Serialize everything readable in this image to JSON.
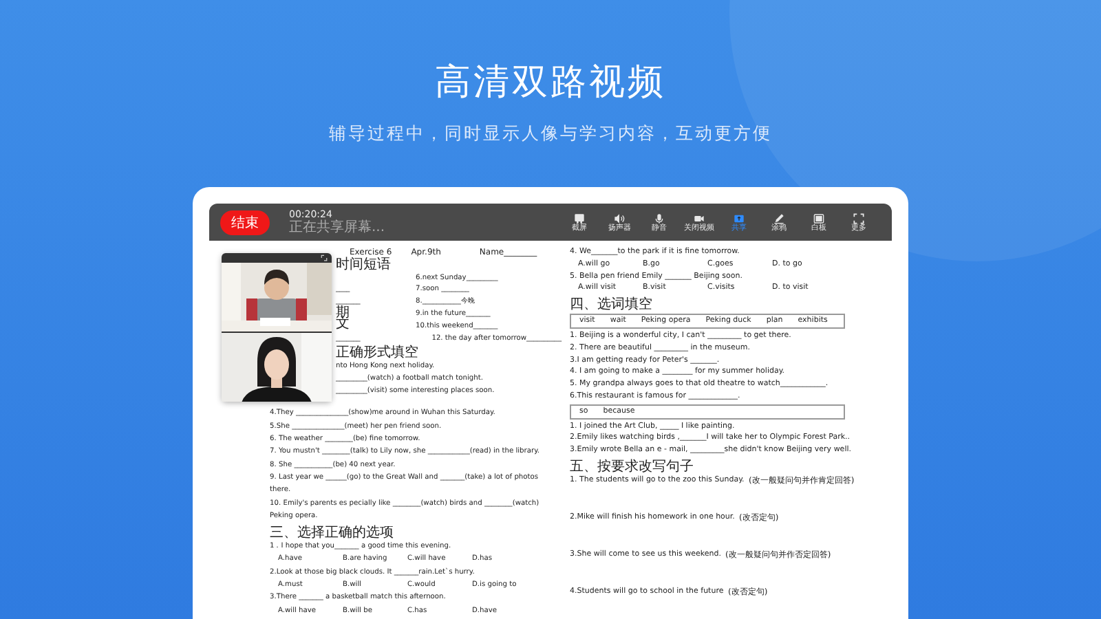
{
  "headline": "高清双路视频",
  "subheadline": "辅导过程中，同时显示人像与学习内容，互动更方便",
  "toolbar": {
    "end_button": "结束",
    "timer": "00:20:24",
    "status": "正在共享屏幕...",
    "tools": [
      {
        "label": "截屏",
        "selected": false
      },
      {
        "label": "扬声器",
        "selected": false
      },
      {
        "label": "静音",
        "selected": false
      },
      {
        "label": "关闭视频",
        "selected": false
      },
      {
        "label": "共享",
        "selected": true
      },
      {
        "label": "涂鸦",
        "selected": false
      },
      {
        "label": "白板",
        "selected": false
      },
      {
        "label": "更多",
        "selected": false
      }
    ]
  },
  "worksheet": {
    "header": [
      "Exercise 6",
      "Apr.9th",
      "Name________"
    ],
    "top_rows": [
      {
        "left": "时间短语",
        "right": ""
      },
      {
        "left": "",
        "right": "6.next Sunday_________"
      },
      {
        "left": "____",
        "right": "7.soon ________"
      },
      {
        "left": "_______",
        "right": "8.___________今晚"
      },
      {
        "left": "期",
        "right": "9.in the future_______"
      },
      {
        "left": "文",
        "right": "10.this weekend_______"
      },
      {
        "left": "_______",
        "right": "12.    the day after tomorrow__________"
      }
    ],
    "left": [
      {
        "kind": "heading",
        "text": "正确形式填空"
      },
      {
        "kind": "line",
        "text": "nto Hong Kong next holiday."
      },
      {
        "kind": "line",
        "text": "_________(watch) a football match  tonight."
      },
      {
        "kind": "line",
        "text": "_________(visit) some interesting places soon."
      },
      {
        "kind": "line",
        "text": "4.They _______________(show)me around in Wuhan this Saturday."
      },
      {
        "kind": "line",
        "text": "5.She _______________(meet) her pen friend soon."
      },
      {
        "kind": "line",
        "text": "6. The weather ________(be) fine tomorrow."
      },
      {
        "kind": "line",
        "text": "7. You mustn't ________(talk) to Lily now, she ____________(read) in the library."
      },
      {
        "kind": "line",
        "text": "8. She ___________(be) 40 next year."
      },
      {
        "kind": "line",
        "text": "9. Last year we ______(go) to the Great Wall and _______(take) a lot of photos"
      },
      {
        "kind": "line",
        "text": "there."
      },
      {
        "kind": "line",
        "text": "10. Emily's parents es pecially like ________(watch) birds and ________(watch)"
      },
      {
        "kind": "line",
        "text": "Peking opera."
      },
      {
        "kind": "heading",
        "text": "三、选择正确的选项"
      },
      {
        "kind": "line",
        "text": "1．I hope that you_______ a good time this evening."
      },
      {
        "kind": "options",
        "items": [
          "A.have",
          "B.are having",
          "C.will have",
          "D.has"
        ]
      },
      {
        "kind": "line",
        "text": "2.Look at those big black clouds. It _______rain.Let`s hurry."
      },
      {
        "kind": "options",
        "items": [
          "A.must",
          "B.will",
          "C.would",
          "D.is going to"
        ]
      },
      {
        "kind": "line",
        "text": "3.There _______ a basketball match this afternoon."
      },
      {
        "kind": "options",
        "items": [
          "A.will have",
          "B.will be",
          "C.has",
          "D.have"
        ]
      }
    ],
    "right": [
      {
        "kind": "line",
        "text": "4. We_______to the park if it is fine tomorrow."
      },
      {
        "kind": "options",
        "items": [
          "A.will go",
          "B.go",
          "C.goes",
          "D. to go"
        ]
      },
      {
        "kind": "line",
        "text": "5. Bella pen friend Emily _______ Beijing soon."
      },
      {
        "kind": "options",
        "items": [
          "A.will visit",
          "B.visit",
          "C.visits",
          "D. to visit"
        ]
      },
      {
        "kind": "heading",
        "text": "四、选词填空"
      },
      {
        "kind": "wordbox",
        "items": [
          "visit",
          "wait",
          "Peking opera",
          "Peking duck",
          "plan",
          "exhibits"
        ]
      },
      {
        "kind": "line",
        "text": "1. Beijing is a wonderful city, I can't _________ to get there."
      },
      {
        "kind": "line",
        "text": "2. There are beautiful _________ in the museum."
      },
      {
        "kind": "line",
        "text": "3.I am getting ready for Peter's _______."
      },
      {
        "kind": "line",
        "text": "4. I am going to make a ________ for my summer holiday."
      },
      {
        "kind": "line",
        "text": "5. My grandpa always goes to that old theatre to watch____________."
      },
      {
        "kind": "line",
        "text": "6.This restaurant is famous for _____________."
      },
      {
        "kind": "wordbox",
        "items": [
          "so",
          "because"
        ]
      },
      {
        "kind": "line",
        "text": "1. I joined the Art Club, _____ I like painting."
      },
      {
        "kind": "line",
        "text": "2.Emily likes watching birds ,_______I will take her to Olympic Forest Park.."
      },
      {
        "kind": "line",
        "text": "3.Emily wrote Bella an e - mail, _________she didn't know Beijing very well."
      },
      {
        "kind": "heading",
        "text": "五、按要求改写句子"
      },
      {
        "kind": "task",
        "text": "1. The students will go to the zoo this Sunday.",
        "note": "(改一般疑问句并作肯定回答)"
      },
      {
        "kind": "task",
        "text": "2.Mike will finish his homework in one hour.",
        "note": "(改否定句)"
      },
      {
        "kind": "task",
        "text": "3.She will come to see us this weekend.",
        "note": "(改一般疑问句并作否定回答)"
      },
      {
        "kind": "task",
        "text": "4.Students will go to school in the future",
        "note": "(改否定句)"
      }
    ]
  }
}
